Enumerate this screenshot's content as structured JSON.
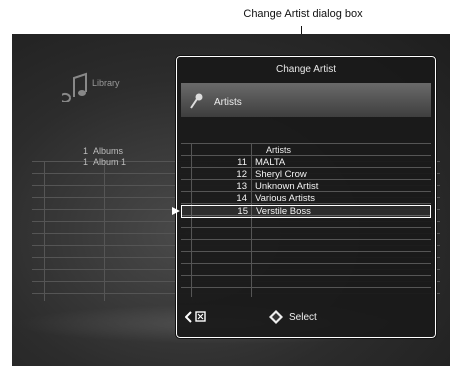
{
  "callout": {
    "text": "Change Artist dialog box"
  },
  "background": {
    "library_label": "Library",
    "rows": [
      {
        "num": "1",
        "label": "Albums"
      },
      {
        "num": "1",
        "label": "Album 1"
      }
    ]
  },
  "dialog": {
    "title": "Change Artist",
    "header_label": "Artists",
    "list_header": "Artists",
    "items": [
      {
        "num": "11",
        "name": "MALTA"
      },
      {
        "num": "12",
        "name": "Sheryl Crow"
      },
      {
        "num": "13",
        "name": "Unknown Artist"
      },
      {
        "num": "14",
        "name": "Various Artists"
      },
      {
        "num": "15",
        "name": "Verstile Boss"
      }
    ],
    "selected_index": 4,
    "footer": {
      "select_label": "Select"
    }
  },
  "icons": {
    "library": "music-note-icon",
    "header": "microphone-icon",
    "back": "back-arrow-icon",
    "cancel": "cancel-box-icon",
    "select": "select-diamond-icon",
    "marker": "selection-marker-icon"
  }
}
